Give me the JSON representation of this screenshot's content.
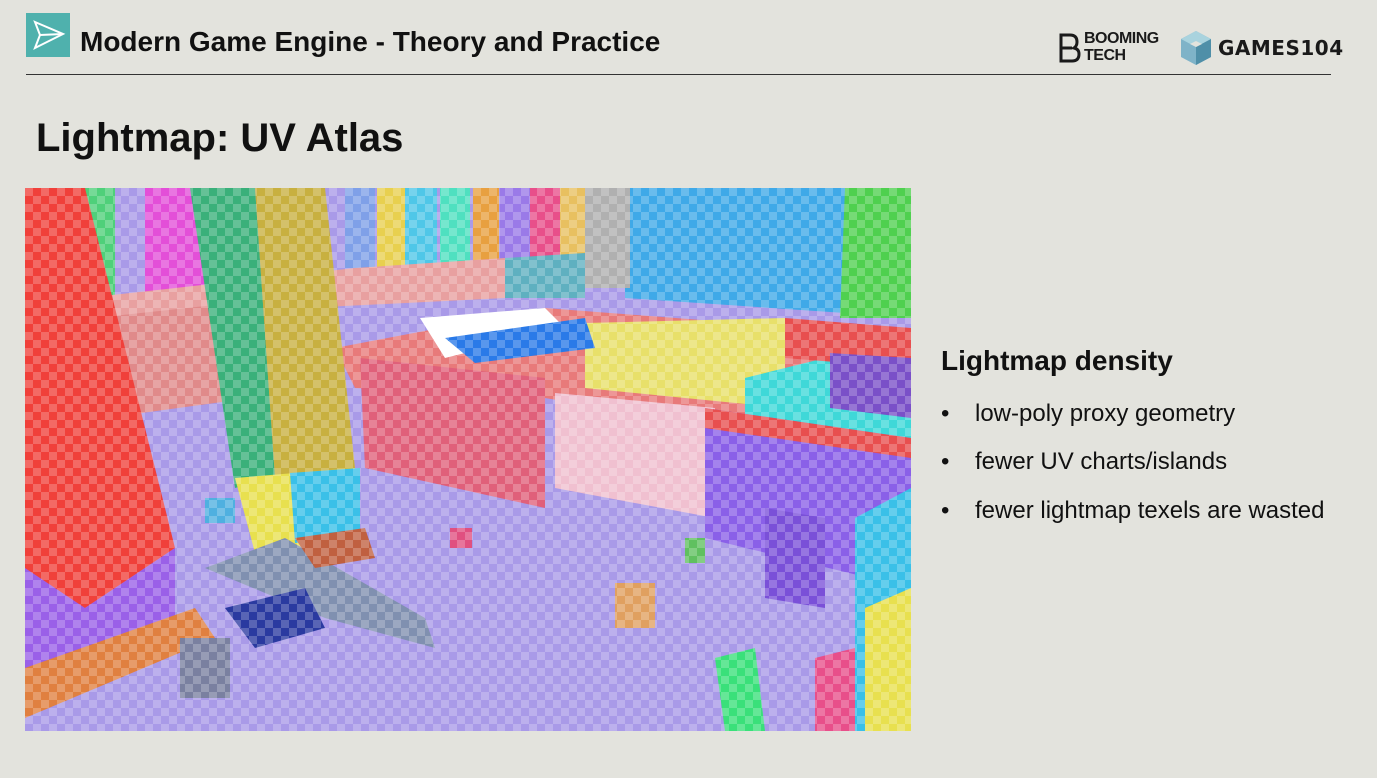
{
  "header": {
    "course_title": "Modern Game Engine - Theory and Practice",
    "brand_booming_line1": "BOOMING",
    "brand_booming_line2": "TECH",
    "brand_games": "GAMES104"
  },
  "slide": {
    "title": "Lightmap: UV Atlas",
    "section_heading": "Lightmap density",
    "bullets": [
      "low-poly proxy geometry",
      "fewer UV charts/islands",
      "fewer lightmap texels are wasted"
    ]
  },
  "colors": {
    "accent": "#4fb1ad",
    "background": "#e3e3dd"
  },
  "icons": {
    "logo": "paper-plane-icon",
    "booming": "booming-b-icon",
    "games": "cube-icon"
  }
}
